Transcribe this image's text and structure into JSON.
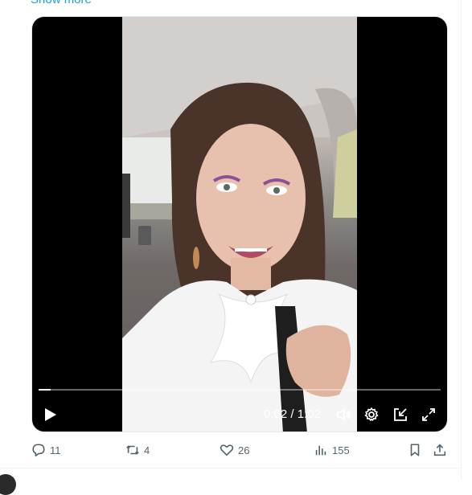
{
  "tweet": {
    "show_more_label": "Show more"
  },
  "video": {
    "current_time": "0:02",
    "separator": "/",
    "duration": "1:02",
    "progress_fraction": 0.03,
    "state": "paused"
  },
  "controls": {
    "play_icon": "play-icon",
    "volume_icon": "volume-icon",
    "settings_icon": "gear-icon",
    "dock_icon": "dock-icon",
    "fullscreen_icon": "fullscreen-icon"
  },
  "actions": {
    "replies": "11",
    "reposts": "4",
    "likes": "26",
    "views": "155"
  },
  "colors": {
    "accent": "#1d9bf0",
    "icon_gray": "#536471",
    "player_bg": "#000000"
  }
}
